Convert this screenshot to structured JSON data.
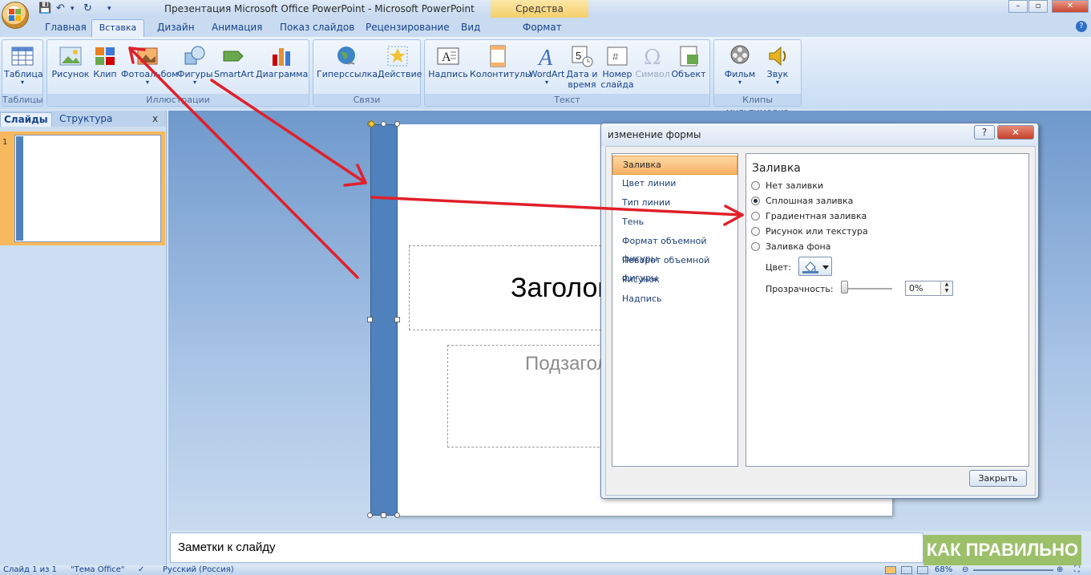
{
  "titlebar": {
    "window_title": "Презентация Microsoft Office PowerPoint - Microsoft PowerPoint",
    "context_tools": "Средства рисования",
    "qat_icons": [
      "save-icon",
      "undo-icon",
      "redo-icon"
    ]
  },
  "tabs": [
    "Главная",
    "Вставка",
    "Дизайн",
    "Анимация",
    "Показ слайдов",
    "Рецензирование",
    "Вид",
    "Формат"
  ],
  "active_tab": "Вставка",
  "ribbon": {
    "groups": [
      {
        "label": "Таблицы",
        "items": [
          {
            "label": "Таблица",
            "dropdown": "▾"
          }
        ]
      },
      {
        "label": "Иллюстрации",
        "items": [
          {
            "label": "Рисунок"
          },
          {
            "label": "Клип"
          },
          {
            "label": "Фотоальбом",
            "dropdown": "▾"
          },
          {
            "label": "Фигуры",
            "dropdown": "▾"
          },
          {
            "label": "SmartArt"
          },
          {
            "label": "Диаграмма"
          }
        ]
      },
      {
        "label": "Связи",
        "items": [
          {
            "label": "Гиперссылка"
          },
          {
            "label": "Действие"
          }
        ]
      },
      {
        "label": "Текст",
        "items": [
          {
            "label": "Надпись"
          },
          {
            "label": "Колонтитулы"
          },
          {
            "label": "WordArt",
            "dropdown": "▾"
          },
          {
            "label": "Дата и время"
          },
          {
            "label": "Номер слайда"
          },
          {
            "label": "Символ"
          },
          {
            "label": "Объект"
          }
        ]
      },
      {
        "label": "Клипы мультимедиа",
        "items": [
          {
            "label": "Фильм",
            "dropdown": "▾"
          },
          {
            "label": "Звук",
            "dropdown": "▾"
          }
        ]
      }
    ]
  },
  "left_pane": {
    "tabs": [
      "Слайды",
      "Структура"
    ],
    "close": "x",
    "slide_number": "1"
  },
  "slide": {
    "title_placeholder": "Заголовок слайда",
    "subtitle_placeholder": "Подзаголовок слайда"
  },
  "notes_placeholder": "Заметки к слайду",
  "watermark": "КАК ПРАВИЛЬНО",
  "status": {
    "slide": "Слайд 1 из 1",
    "theme": "\"Тема Office\"",
    "language": "Русский (Россия)",
    "zoom": "68%"
  },
  "dialog": {
    "title": "изменение формы",
    "help": "?",
    "close_x": "✕",
    "categories": [
      "Заливка",
      "Цвет линии",
      "Тип линии",
      "Тень",
      "Формат объемной фигуры",
      "Поворот объемной фигуры",
      "Рисунок",
      "Надпись"
    ],
    "selected_category": "Заливка",
    "section_title": "Заливка",
    "fill_options": [
      "Нет заливки",
      "Сплошная заливка",
      "Градиентная заливка",
      "Рисунок или текстура",
      "Заливка фона"
    ],
    "selected_option": "Сплошная заливка",
    "color_label": "Цвет:",
    "transparency_label": "Прозрачность:",
    "transparency_value": "0%",
    "transparency": 0,
    "close_button": "Закрыть"
  },
  "colors": {
    "accent_shape": "#4f81bd",
    "annotation_arrows": "#e0202a",
    "selected_category": "#f7b065"
  }
}
